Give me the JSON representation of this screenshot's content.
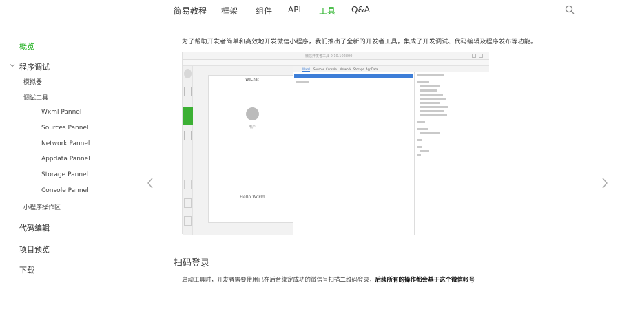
{
  "nav": {
    "items": [
      "简易教程",
      "框架",
      "组件",
      "API",
      "工具",
      "Q&A"
    ],
    "active": "工具"
  },
  "sidebar": {
    "overview": "概览",
    "debug": "程序调试",
    "simulator": "模拟器",
    "debug_tools": "调试工具",
    "panels": [
      "Wxml Pannel",
      "Sources Pannel",
      "Network Pannel",
      "Appdata Pannel",
      "Storage Pannel",
      "Console Pannel"
    ],
    "ops": "小程序操作区",
    "code_edit": "代码编辑",
    "preview": "项目预览",
    "download": "下载"
  },
  "main": {
    "intro": "为了帮助开发者简单和高效地开发微信小程序，我们推出了全新的开发者工具，集成了开发调试、代码编辑及程序发布等功能。",
    "section_title": "扫码登录",
    "section_text": "启动工具时，开发者需要使用已在后台绑定成功的微信号扫描二维码登录，",
    "section_text_bold": "后续所有的操作都会基于这个微信帐号"
  },
  "screenshot": {
    "window_title": "微信开发者工具 0.10.102800",
    "phone_title": "WeChat",
    "user_name": "用户",
    "hello": "Hello World",
    "devtools_tabs": [
      "Wxml",
      "Sources",
      "Console",
      "Network",
      "Storage",
      "AppData"
    ],
    "devtools_selected": "Wxml"
  },
  "colors": {
    "accent": "#1aad19",
    "devtools_highlight": "#3d7ed8"
  }
}
